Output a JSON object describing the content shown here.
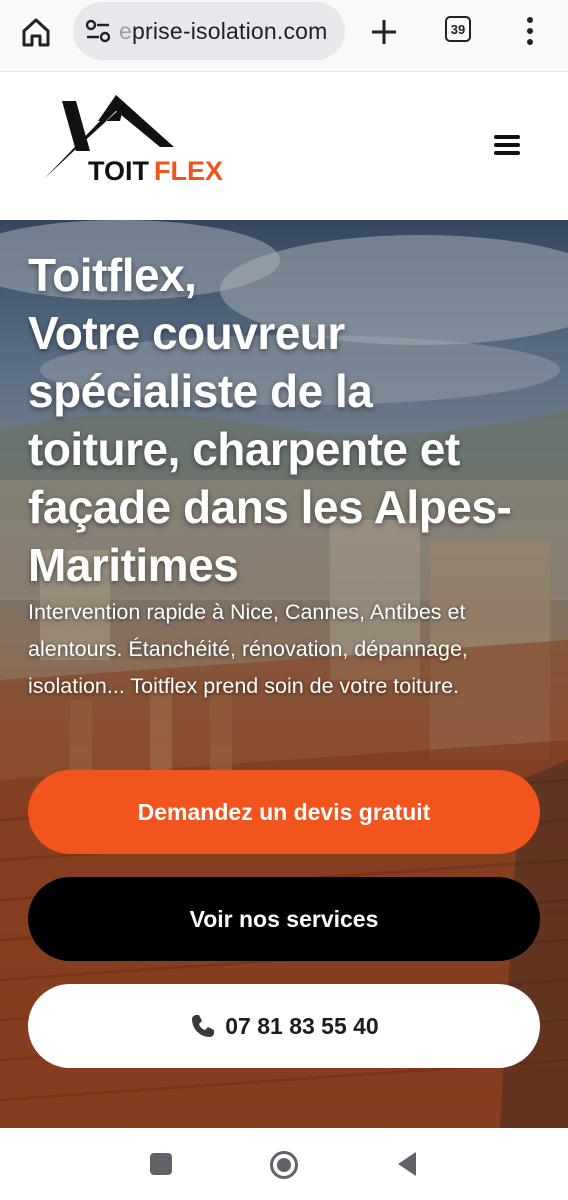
{
  "browser": {
    "url_faded": "e",
    "url_rest": "prise-isolation.com",
    "tab_count": "39",
    "icons": [
      "home-icon",
      "site-settings-icon",
      "plus-icon",
      "tabs-icon",
      "more-vert-icon"
    ]
  },
  "header": {
    "logo": {
      "word_black": "TOIT",
      "word_orange": "FLEX"
    },
    "menu_icon": "hamburger-icon"
  },
  "hero": {
    "title_lines": [
      "Toitflex,",
      "Votre couvreur",
      "spécialiste de la",
      "toiture, charpente et",
      "façade dans les Alpes-",
      "Maritimes"
    ],
    "intro": "Intervention rapide à Nice, Cannes, Antibes et alentours. Étanchéité, rénovation, dépannage, isolation... Toitflex prend soin de votre toiture.",
    "cta_quote": "Demandez un devis gratuit",
    "cta_services": "Voir nos services",
    "cta_phone": "07 81 83 55 40"
  },
  "colors": {
    "accent_orange": "#f1541d",
    "button_black": "#000000",
    "button_white": "#ffffff",
    "browser_bar": "#f8f9fa"
  },
  "android_nav": [
    "recent-apps-icon",
    "home-circle-icon",
    "back-triangle-icon"
  ]
}
